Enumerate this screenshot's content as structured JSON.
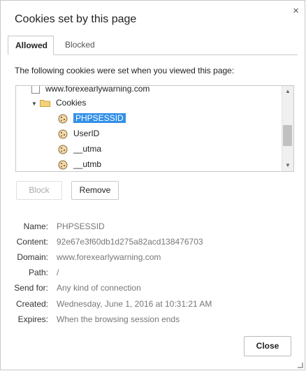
{
  "dialog": {
    "title": "Cookies set by this page",
    "close_glyph": "×"
  },
  "tabs": [
    {
      "label": "Allowed",
      "active": true
    },
    {
      "label": "Blocked",
      "active": false
    }
  ],
  "description": "The following cookies were set when you viewed this page:",
  "tree": {
    "domain_row": "www.forexearlywarning.com",
    "folder_label": "Cookies",
    "cookies": [
      "PHPSESSID",
      "UserID",
      "__utma",
      "__utmb"
    ],
    "selected": "PHPSESSID"
  },
  "buttons": {
    "block": "Block",
    "remove": "Remove",
    "close": "Close"
  },
  "details": [
    {
      "label": "Name:",
      "value": "PHPSESSID"
    },
    {
      "label": "Content:",
      "value": "92e67e3f60db1d275a82acd138476703"
    },
    {
      "label": "Domain:",
      "value": "www.forexearlywarning.com"
    },
    {
      "label": "Path:",
      "value": "/"
    },
    {
      "label": "Send for:",
      "value": "Any kind of connection"
    },
    {
      "label": "Created:",
      "value": "Wednesday, June 1, 2016 at 10:31:21 AM"
    },
    {
      "label": "Expires:",
      "value": "When the browsing session ends"
    }
  ],
  "colors": {
    "selection": "#3390e8",
    "border": "#c8c8c8"
  }
}
